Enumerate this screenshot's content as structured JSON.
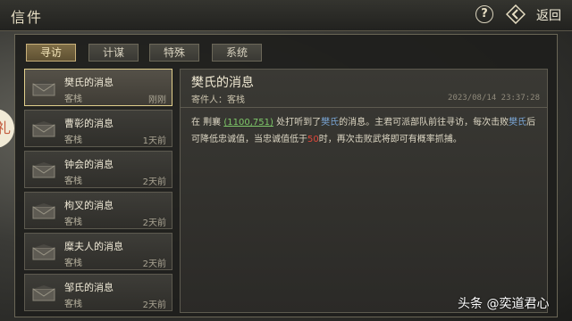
{
  "header": {
    "title": "信件",
    "help_label": "?",
    "back_label": "返回"
  },
  "tabs": [
    {
      "label": "寻访",
      "active": true
    },
    {
      "label": "计谋",
      "active": false
    },
    {
      "label": "特殊",
      "active": false
    },
    {
      "label": "系统",
      "active": false
    }
  ],
  "messages": [
    {
      "title": "樊氏的消息",
      "sender": "客栈",
      "time": "刚刚"
    },
    {
      "title": "曹彰的消息",
      "sender": "客栈",
      "time": "1天前"
    },
    {
      "title": "钟会的消息",
      "sender": "客栈",
      "time": "2天前"
    },
    {
      "title": "枸叉的消息",
      "sender": "客栈",
      "time": "2天前"
    },
    {
      "title": "糜夫人的消息",
      "sender": "客栈",
      "time": "2天前"
    },
    {
      "title": "邹氏的消息",
      "sender": "客栈",
      "time": "2天前"
    }
  ],
  "detail": {
    "title": "樊氏的消息",
    "sender_label": "寄件人：客栈",
    "date": "2023/08/14 23:37:28",
    "body": {
      "part1": "在 荆襄 ",
      "coords": "(1100,751)",
      "part2": " 处打听到了",
      "name1": "樊氏",
      "part3": "的消息。主君可派部队前往寻访，每次击败",
      "name2": "樊氏",
      "part4": "后可降低忠诚值，当忠诚值低于",
      "threshold": "50",
      "part5": "时，再次击败武将即可有概率抓捕。"
    }
  },
  "side_badge": "礼",
  "watermark": "头条 @奕道君心",
  "colors": {
    "accent_gold": "#e1cf8c",
    "coords_green": "#7fc96a",
    "name_blue": "#7aa7d8",
    "threshold_red": "#e0483b"
  }
}
